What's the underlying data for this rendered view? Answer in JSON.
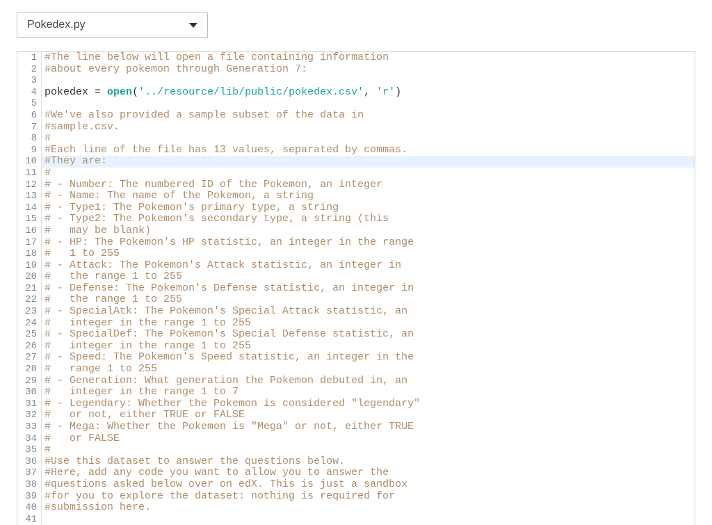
{
  "file_selector": {
    "selected": "Pokedex.py"
  },
  "editor": {
    "highlighted_line": 10,
    "visible_start": 1,
    "visible_end": 41,
    "lines": [
      {
        "n": 1,
        "tokens": [
          {
            "t": "comment",
            "v": "#The line below will open a file containing information"
          }
        ]
      },
      {
        "n": 2,
        "tokens": [
          {
            "t": "comment",
            "v": "#about every pokemon through Generation 7:"
          }
        ]
      },
      {
        "n": 3,
        "tokens": []
      },
      {
        "n": 4,
        "tokens": [
          {
            "t": "ident",
            "v": "pokedex "
          },
          {
            "t": "assign",
            "v": "="
          },
          {
            "t": "ident",
            "v": " "
          },
          {
            "t": "builtin",
            "v": "open"
          },
          {
            "t": "paren",
            "v": "("
          },
          {
            "t": "string",
            "v": "'../resource/lib/public/pokedex.csv'"
          },
          {
            "t": "comma",
            "v": ", "
          },
          {
            "t": "string",
            "v": "'r'"
          },
          {
            "t": "paren",
            "v": ")"
          }
        ]
      },
      {
        "n": 5,
        "tokens": []
      },
      {
        "n": 6,
        "tokens": [
          {
            "t": "comment",
            "v": "#We've also provided a sample subset of the data in"
          }
        ]
      },
      {
        "n": 7,
        "tokens": [
          {
            "t": "comment",
            "v": "#sample.csv."
          }
        ]
      },
      {
        "n": 8,
        "tokens": [
          {
            "t": "comment",
            "v": "#"
          }
        ]
      },
      {
        "n": 9,
        "tokens": [
          {
            "t": "comment",
            "v": "#Each line of the file has 13 values, separated by commas."
          }
        ]
      },
      {
        "n": 10,
        "tokens": [
          {
            "t": "comment",
            "v": "#They are:"
          }
        ]
      },
      {
        "n": 11,
        "tokens": [
          {
            "t": "comment",
            "v": "#"
          }
        ]
      },
      {
        "n": 12,
        "tokens": [
          {
            "t": "comment",
            "v": "# - Number: The numbered ID of the Pokemon, an integer"
          }
        ]
      },
      {
        "n": 13,
        "tokens": [
          {
            "t": "comment",
            "v": "# - Name: The name of the Pokemon, a string"
          }
        ]
      },
      {
        "n": 14,
        "tokens": [
          {
            "t": "comment",
            "v": "# - Type1: The Pokemon's primary type, a string"
          }
        ]
      },
      {
        "n": 15,
        "tokens": [
          {
            "t": "comment",
            "v": "# - Type2: The Pokemon's secondary type, a string (this"
          }
        ]
      },
      {
        "n": 16,
        "tokens": [
          {
            "t": "comment",
            "v": "#   may be blank)"
          }
        ]
      },
      {
        "n": 17,
        "tokens": [
          {
            "t": "comment",
            "v": "# - HP: The Pokemon's HP statistic, an integer in the range"
          }
        ]
      },
      {
        "n": 18,
        "tokens": [
          {
            "t": "comment",
            "v": "#   1 to 255"
          }
        ]
      },
      {
        "n": 19,
        "tokens": [
          {
            "t": "comment",
            "v": "# - Attack: The Pokemon's Attack statistic, an integer in"
          }
        ]
      },
      {
        "n": 20,
        "tokens": [
          {
            "t": "comment",
            "v": "#   the range 1 to 255"
          }
        ]
      },
      {
        "n": 21,
        "tokens": [
          {
            "t": "comment",
            "v": "# - Defense: The Pokemon's Defense statistic, an integer in"
          }
        ]
      },
      {
        "n": 22,
        "tokens": [
          {
            "t": "comment",
            "v": "#   the range 1 to 255"
          }
        ]
      },
      {
        "n": 23,
        "tokens": [
          {
            "t": "comment",
            "v": "# - SpecialAtk: The Pokemon's Special Attack statistic, an"
          }
        ]
      },
      {
        "n": 24,
        "tokens": [
          {
            "t": "comment",
            "v": "#   integer in the range 1 to 255"
          }
        ]
      },
      {
        "n": 25,
        "tokens": [
          {
            "t": "comment",
            "v": "# - SpecialDef: The Pokemon's Special Defense statistic, an"
          }
        ]
      },
      {
        "n": 26,
        "tokens": [
          {
            "t": "comment",
            "v": "#   integer in the range 1 to 255"
          }
        ]
      },
      {
        "n": 27,
        "tokens": [
          {
            "t": "comment",
            "v": "# - Speed: The Pokemon's Speed statistic, an integer in the"
          }
        ]
      },
      {
        "n": 28,
        "tokens": [
          {
            "t": "comment",
            "v": "#   range 1 to 255"
          }
        ]
      },
      {
        "n": 29,
        "tokens": [
          {
            "t": "comment",
            "v": "# - Generation: What generation the Pokemon debuted in, an"
          }
        ]
      },
      {
        "n": 30,
        "tokens": [
          {
            "t": "comment",
            "v": "#   integer in the range 1 to 7"
          }
        ]
      },
      {
        "n": 31,
        "tokens": [
          {
            "t": "comment",
            "v": "# - Legendary: Whether the Pokemon is considered \"legendary\""
          }
        ]
      },
      {
        "n": 32,
        "tokens": [
          {
            "t": "comment",
            "v": "#   or not, either TRUE or FALSE"
          }
        ]
      },
      {
        "n": 33,
        "tokens": [
          {
            "t": "comment",
            "v": "# - Mega: Whether the Pokemon is \"Mega\" or not, either TRUE"
          }
        ]
      },
      {
        "n": 34,
        "tokens": [
          {
            "t": "comment",
            "v": "#   or FALSE"
          }
        ]
      },
      {
        "n": 35,
        "tokens": [
          {
            "t": "comment",
            "v": "#"
          }
        ]
      },
      {
        "n": 36,
        "tokens": [
          {
            "t": "comment",
            "v": "#Use this dataset to answer the questions below."
          }
        ]
      },
      {
        "n": 37,
        "tokens": [
          {
            "t": "comment",
            "v": "#Here, add any code you want to allow you to answer the"
          }
        ]
      },
      {
        "n": 38,
        "tokens": [
          {
            "t": "comment",
            "v": "#questions asked below over on edX. This is just a sandbox"
          }
        ]
      },
      {
        "n": 39,
        "tokens": [
          {
            "t": "comment",
            "v": "#for you to explore the dataset: nothing is required for"
          }
        ]
      },
      {
        "n": 40,
        "tokens": [
          {
            "t": "comment",
            "v": "#submission here."
          }
        ]
      },
      {
        "n": 41,
        "tokens": []
      }
    ]
  }
}
